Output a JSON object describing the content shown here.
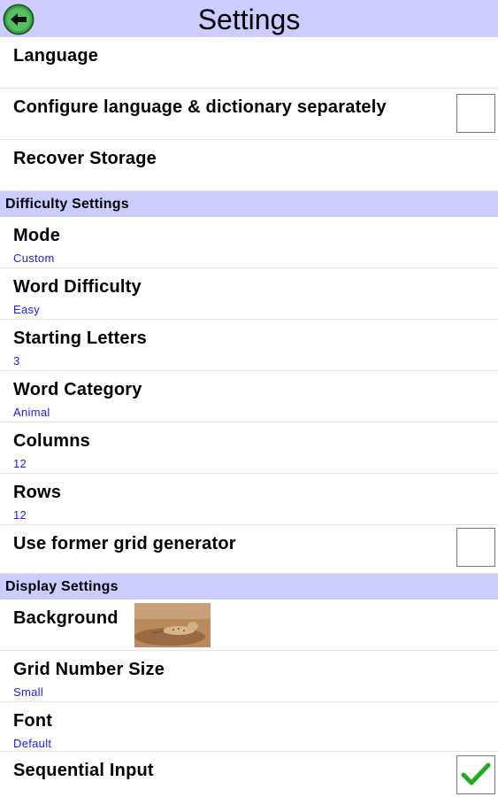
{
  "header": {
    "title": "Settings",
    "back_icon": "back-arrow-icon"
  },
  "colors": {
    "header_bg": "#ccccff",
    "value_text": "#1a1aff",
    "check_green": "#22aa22"
  },
  "general": [
    {
      "label": "Language"
    },
    {
      "label": "Configure language & dictionary separately",
      "checked": false
    },
    {
      "label": "Recover Storage"
    }
  ],
  "sections": {
    "difficulty": "Difficulty Settings",
    "display": "Display Settings"
  },
  "difficulty": [
    {
      "label": "Mode",
      "value": "Custom"
    },
    {
      "label": "Word Difficulty",
      "value": "Easy"
    },
    {
      "label": "Starting Letters",
      "value": "3"
    },
    {
      "label": "Word Category",
      "value": "Animal"
    },
    {
      "label": "Columns",
      "value": "12"
    },
    {
      "label": "Rows",
      "value": "12"
    },
    {
      "label": "Use former grid generator",
      "checked": false
    }
  ],
  "display": [
    {
      "label": "Background",
      "thumbnail": "cheetah-background-image"
    },
    {
      "label": "Grid Number Size",
      "value": "Small"
    },
    {
      "label": "Font",
      "value": "Default"
    },
    {
      "label": "Sequential Input",
      "checked": true
    }
  ]
}
